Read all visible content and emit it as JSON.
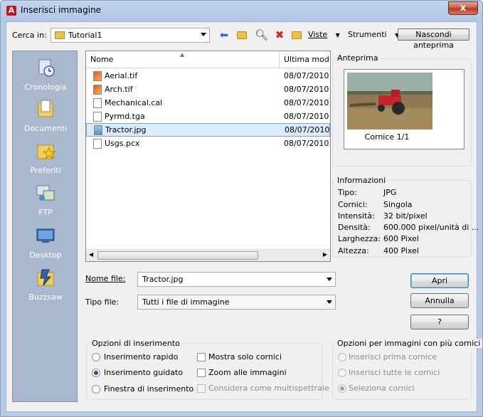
{
  "window": {
    "title": "Inserisci immagine",
    "close_glyph": "x"
  },
  "toolbar": {
    "look_in_label": "Cerca in:",
    "look_in_value": "Tutorial1",
    "views_label": "Viste",
    "tools_label": "Strumenti",
    "hide_preview_label": "Nascondi anteprima"
  },
  "places": [
    {
      "label": "Cronologia",
      "icon": "history-icon"
    },
    {
      "label": "Documenti",
      "icon": "documents-icon"
    },
    {
      "label": "Preferiti",
      "icon": "favorites-icon"
    },
    {
      "label": "FTP",
      "icon": "ftp-icon"
    },
    {
      "label": "Desktop",
      "icon": "desktop-icon"
    },
    {
      "label": "Buzzsaw",
      "icon": "buzzsaw-icon"
    }
  ],
  "filelist": {
    "columns": [
      "Nome",
      "Ultima mod"
    ],
    "files": [
      {
        "name": "Aerial.tif",
        "date": "08/07/2010",
        "icon": "image-file-icon"
      },
      {
        "name": "Arch.tif",
        "date": "08/07/2010",
        "icon": "image-file-icon"
      },
      {
        "name": "Mechanical.cal",
        "date": "08/07/2010",
        "icon": "file-icon"
      },
      {
        "name": "Pyrmd.tga",
        "date": "08/07/2010",
        "icon": "file-icon"
      },
      {
        "name": "Tractor.jpg",
        "date": "08/07/2010",
        "icon": "image-file-icon",
        "selected": true
      },
      {
        "name": "Usgs.pcx",
        "date": "08/07/2010",
        "icon": "file-icon"
      }
    ]
  },
  "preview": {
    "title": "Anteprima",
    "caption": "Cornice 1/1"
  },
  "info": {
    "title": "Informazioni",
    "rows": [
      {
        "key": "Tipo:",
        "value": "JPG"
      },
      {
        "key": "Cornici:",
        "value": "Singola"
      },
      {
        "key": "Intensità:",
        "value": "32 bit/pixel"
      },
      {
        "key": "Densità:",
        "value": "600.000 pixel/unità di ..."
      },
      {
        "key": "Larghezza:",
        "value": "600 Pixel"
      },
      {
        "key": "Altezza:",
        "value": "400 Pixel"
      }
    ]
  },
  "filename": {
    "label": "Nome file:",
    "value": "Tractor.jpg"
  },
  "filetype": {
    "label": "Tipo file:",
    "value": "Tutti i file di immagine"
  },
  "buttons": {
    "open": "Apri",
    "cancel": "Annulla",
    "help": "?"
  },
  "insert_options": {
    "title": "Opzioni di inserimento",
    "radios": [
      {
        "label": "Inserimento rapido",
        "checked": false
      },
      {
        "label": "Inserimento guidato",
        "checked": true
      },
      {
        "label": "Finestra di inserimento",
        "checked": false
      }
    ],
    "checks": [
      {
        "label": "Mostra solo cornici",
        "checked": false,
        "enabled": true
      },
      {
        "label": "Zoom alle immagini",
        "checked": false,
        "enabled": true
      },
      {
        "label": "Considera come multispettrale",
        "checked": false,
        "enabled": false
      }
    ]
  },
  "multiframe_options": {
    "title": "Opzioni per immagini con più cornici",
    "radios": [
      {
        "label": "Inserisci prima cornice",
        "checked": false
      },
      {
        "label": "Inserisci tutte le cornici",
        "checked": false
      },
      {
        "label": "Seleziona cornici",
        "checked": true
      }
    ]
  },
  "colors": {
    "selection": "#dcebfc",
    "places_bg": "#a9b8cc",
    "close_red": "#c9513b"
  }
}
